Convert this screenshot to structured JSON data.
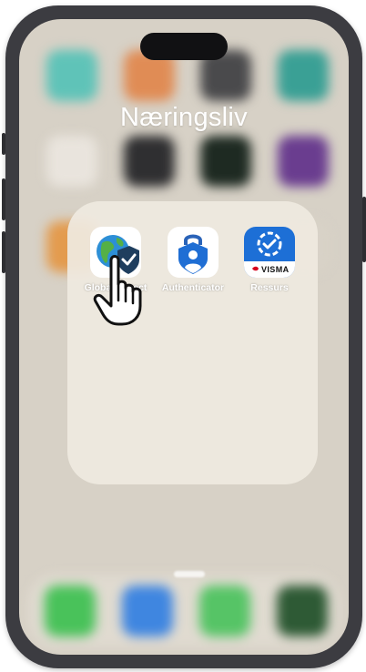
{
  "folder": {
    "title": "Næringsliv",
    "apps": [
      {
        "label": "GlobalProtect",
        "icon": "globalprotect-icon"
      },
      {
        "label": "Authenticator",
        "icon": "authenticator-icon"
      },
      {
        "label": "Ressurs",
        "icon": "visma-ressurs-icon",
        "brand_text": "VISMA"
      }
    ]
  },
  "colors": {
    "device_frame": "#3c3c41",
    "folder_background": "#efeae0",
    "authenticator_blue": "#1f6ed4",
    "ressurs_blue": "#1d6fd6",
    "visma_red": "#d6001c"
  },
  "pointer": {
    "icon": "hand-pointer-icon"
  }
}
